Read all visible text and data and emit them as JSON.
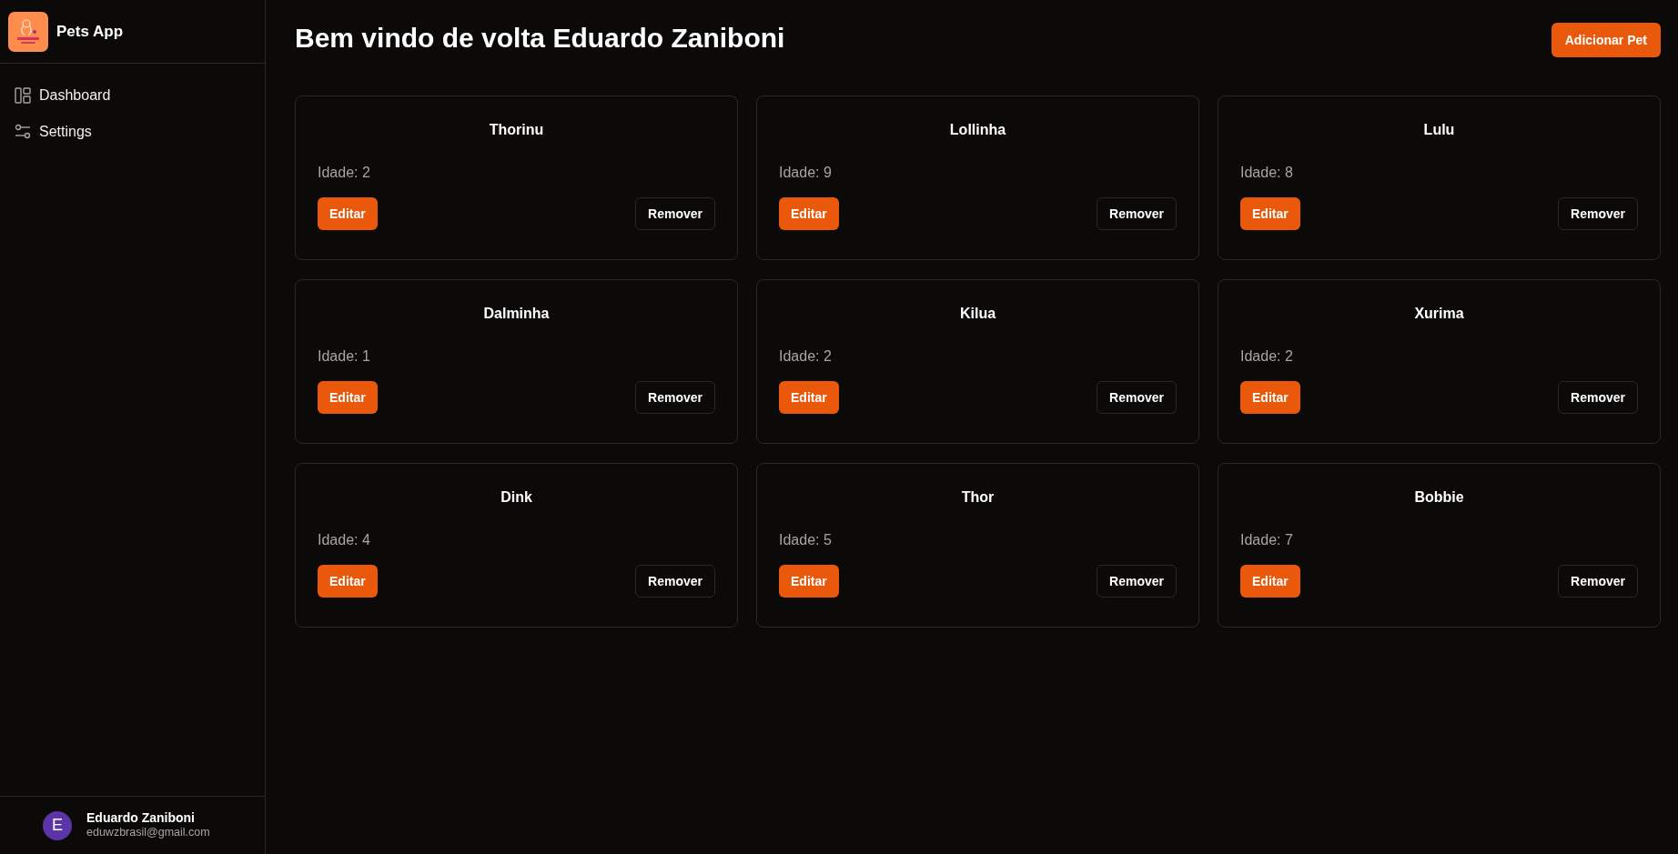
{
  "sidebar": {
    "app_name": "Pets App",
    "items": [
      {
        "label": "Dashboard",
        "kind": "dashboard"
      },
      {
        "label": "Settings",
        "kind": "settings"
      }
    ],
    "user": {
      "initial": "E",
      "name": "Eduardo Zaniboni",
      "email": "eduwzbrasil@gmail.com"
    }
  },
  "header": {
    "title": "Bem vindo de volta Eduardo Zaniboni",
    "action": "Adicionar Pet"
  },
  "pets": [
    {
      "name": "Thorinu",
      "age": "Idade: 2",
      "edit": "Editar",
      "remove": "Remover"
    },
    {
      "name": "Lollinha",
      "age": "Idade: 9",
      "edit": "Editar",
      "remove": "Remover"
    },
    {
      "name": "Lulu",
      "age": "Idade: 8",
      "edit": "Editar",
      "remove": "Remover"
    },
    {
      "name": "Dalminha",
      "age": "Idade: 1",
      "edit": "Editar",
      "remove": "Remover"
    },
    {
      "name": "Kilua",
      "age": "Idade: 2",
      "edit": "Editar",
      "remove": "Remover"
    },
    {
      "name": "Xurima",
      "age": "Idade: 2",
      "edit": "Editar",
      "remove": "Remover"
    },
    {
      "name": "Dink",
      "age": "Idade: 4",
      "edit": "Editar",
      "remove": "Remover"
    },
    {
      "name": "Thor",
      "age": "Idade: 5",
      "edit": "Editar",
      "remove": "Remover"
    },
    {
      "name": "Bobbie",
      "age": "Idade: 7",
      "edit": "Editar",
      "remove": "Remover"
    }
  ]
}
